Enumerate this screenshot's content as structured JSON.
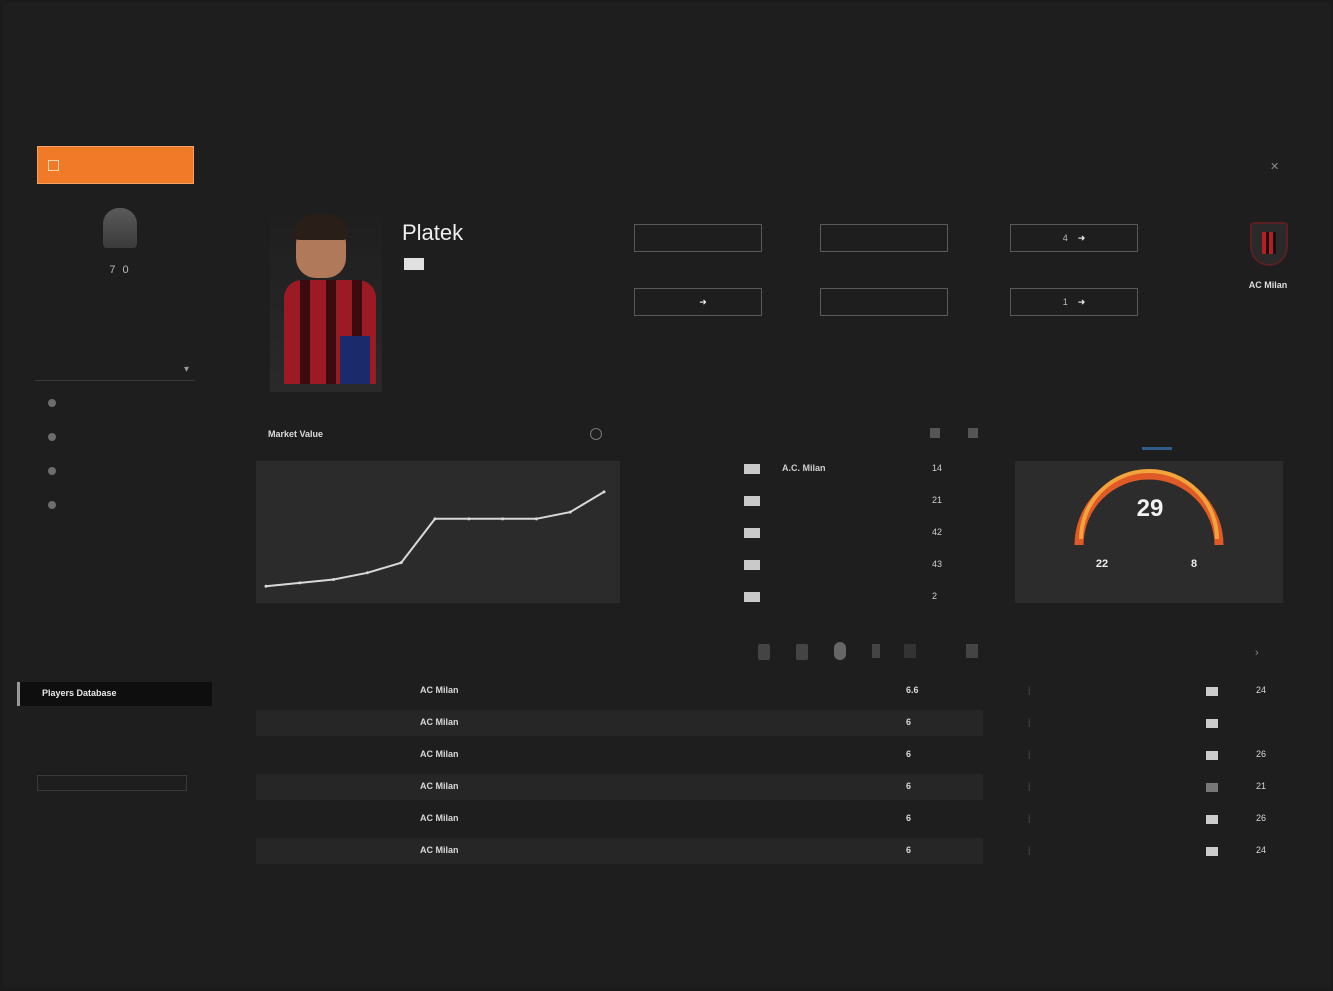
{
  "sidebar": {
    "primary_button": "",
    "user": {
      "name": "",
      "stat": "7  0"
    },
    "filter_label": "",
    "nav": [
      {
        "label": ""
      },
      {
        "label": ""
      },
      {
        "label": ""
      },
      {
        "label": ""
      }
    ],
    "sub_items": [
      {
        "label": ""
      },
      {
        "label": ""
      }
    ],
    "links": [
      {
        "label": ""
      },
      {
        "label": ""
      }
    ],
    "active_item": "Players Database",
    "extra_links": [
      {
        "label": ""
      },
      {
        "label": ""
      }
    ]
  },
  "breadcrumb": {
    "items": [
      "",
      "",
      ""
    ],
    "current": ""
  },
  "player": {
    "position_label": "",
    "name": "Platek",
    "fields": [
      {
        "label": "",
        "value": ""
      },
      {
        "label": "",
        "value": ""
      },
      {
        "label": "",
        "value": "4"
      },
      {
        "label": "",
        "value": ""
      },
      {
        "label": "",
        "value": ""
      },
      {
        "label": "",
        "value": "1"
      }
    ],
    "club": {
      "name": "AC Milan",
      "sub": ""
    }
  },
  "market_value": {
    "title": "Market Value",
    "tooltip": ""
  },
  "career": {
    "title": "",
    "rows": [
      {
        "years": "",
        "team": "A.C. Milan",
        "v1": "14",
        "v2": ""
      },
      {
        "years": "",
        "team": "",
        "v1": "21",
        "v2": ""
      },
      {
        "years": "",
        "team": "",
        "v1": "42",
        "v2": ""
      },
      {
        "years": "",
        "team": "",
        "v1": "43",
        "v2": ""
      },
      {
        "years": "",
        "team": "",
        "v1": "2",
        "v2": ""
      }
    ]
  },
  "season": {
    "title": "",
    "tabs": [
      "",
      ""
    ],
    "gauge_value": "29",
    "stats": [
      {
        "value": "22",
        "label": ""
      },
      {
        "value": "8",
        "label": ""
      }
    ]
  },
  "matches": {
    "headers": [
      "",
      "",
      "",
      "",
      ""
    ],
    "rows": [
      {
        "c1": "",
        "c2": "",
        "team": "AC Milan",
        "opp": "",
        "score": "",
        "rating": "6.6"
      },
      {
        "c1": "",
        "c2": "",
        "team": "AC Milan",
        "opp": "",
        "score": "",
        "rating": "6"
      },
      {
        "c1": "",
        "c2": "",
        "team": "AC Milan",
        "opp": "",
        "score": "",
        "rating": "6"
      },
      {
        "c1": "",
        "c2": "",
        "team": "AC Milan",
        "opp": "",
        "score": "",
        "rating": "6"
      },
      {
        "c1": "",
        "c2": "",
        "team": "AC Milan",
        "opp": "",
        "score": "",
        "rating": "6"
      },
      {
        "c1": "",
        "c2": "",
        "team": "AC Milan",
        "opp": "",
        "score": "",
        "rating": "6"
      }
    ]
  },
  "similar": {
    "title": "",
    "rows": [
      {
        "name": "",
        "value": "24"
      },
      {
        "name": "",
        "value": ""
      },
      {
        "name": "",
        "value": "26"
      },
      {
        "name": "",
        "value": "21"
      },
      {
        "name": "",
        "value": "26"
      },
      {
        "name": "",
        "value": "24"
      }
    ]
  },
  "chart_data": {
    "type": "line",
    "title": "Market Value",
    "x": [
      0,
      1,
      2,
      3,
      4,
      5,
      6,
      7,
      8,
      9,
      10
    ],
    "series": [
      {
        "values": [
          2,
          3,
          4,
          6,
          9,
          22,
          22,
          22,
          22,
          24,
          30
        ]
      }
    ],
    "ylim": [
      0,
      35
    ]
  },
  "colors": {
    "accent": "#f07a28",
    "gauge_arc": "#f2a33a",
    "gauge_track": "#e05a28",
    "milan_red": "#b81c24"
  }
}
